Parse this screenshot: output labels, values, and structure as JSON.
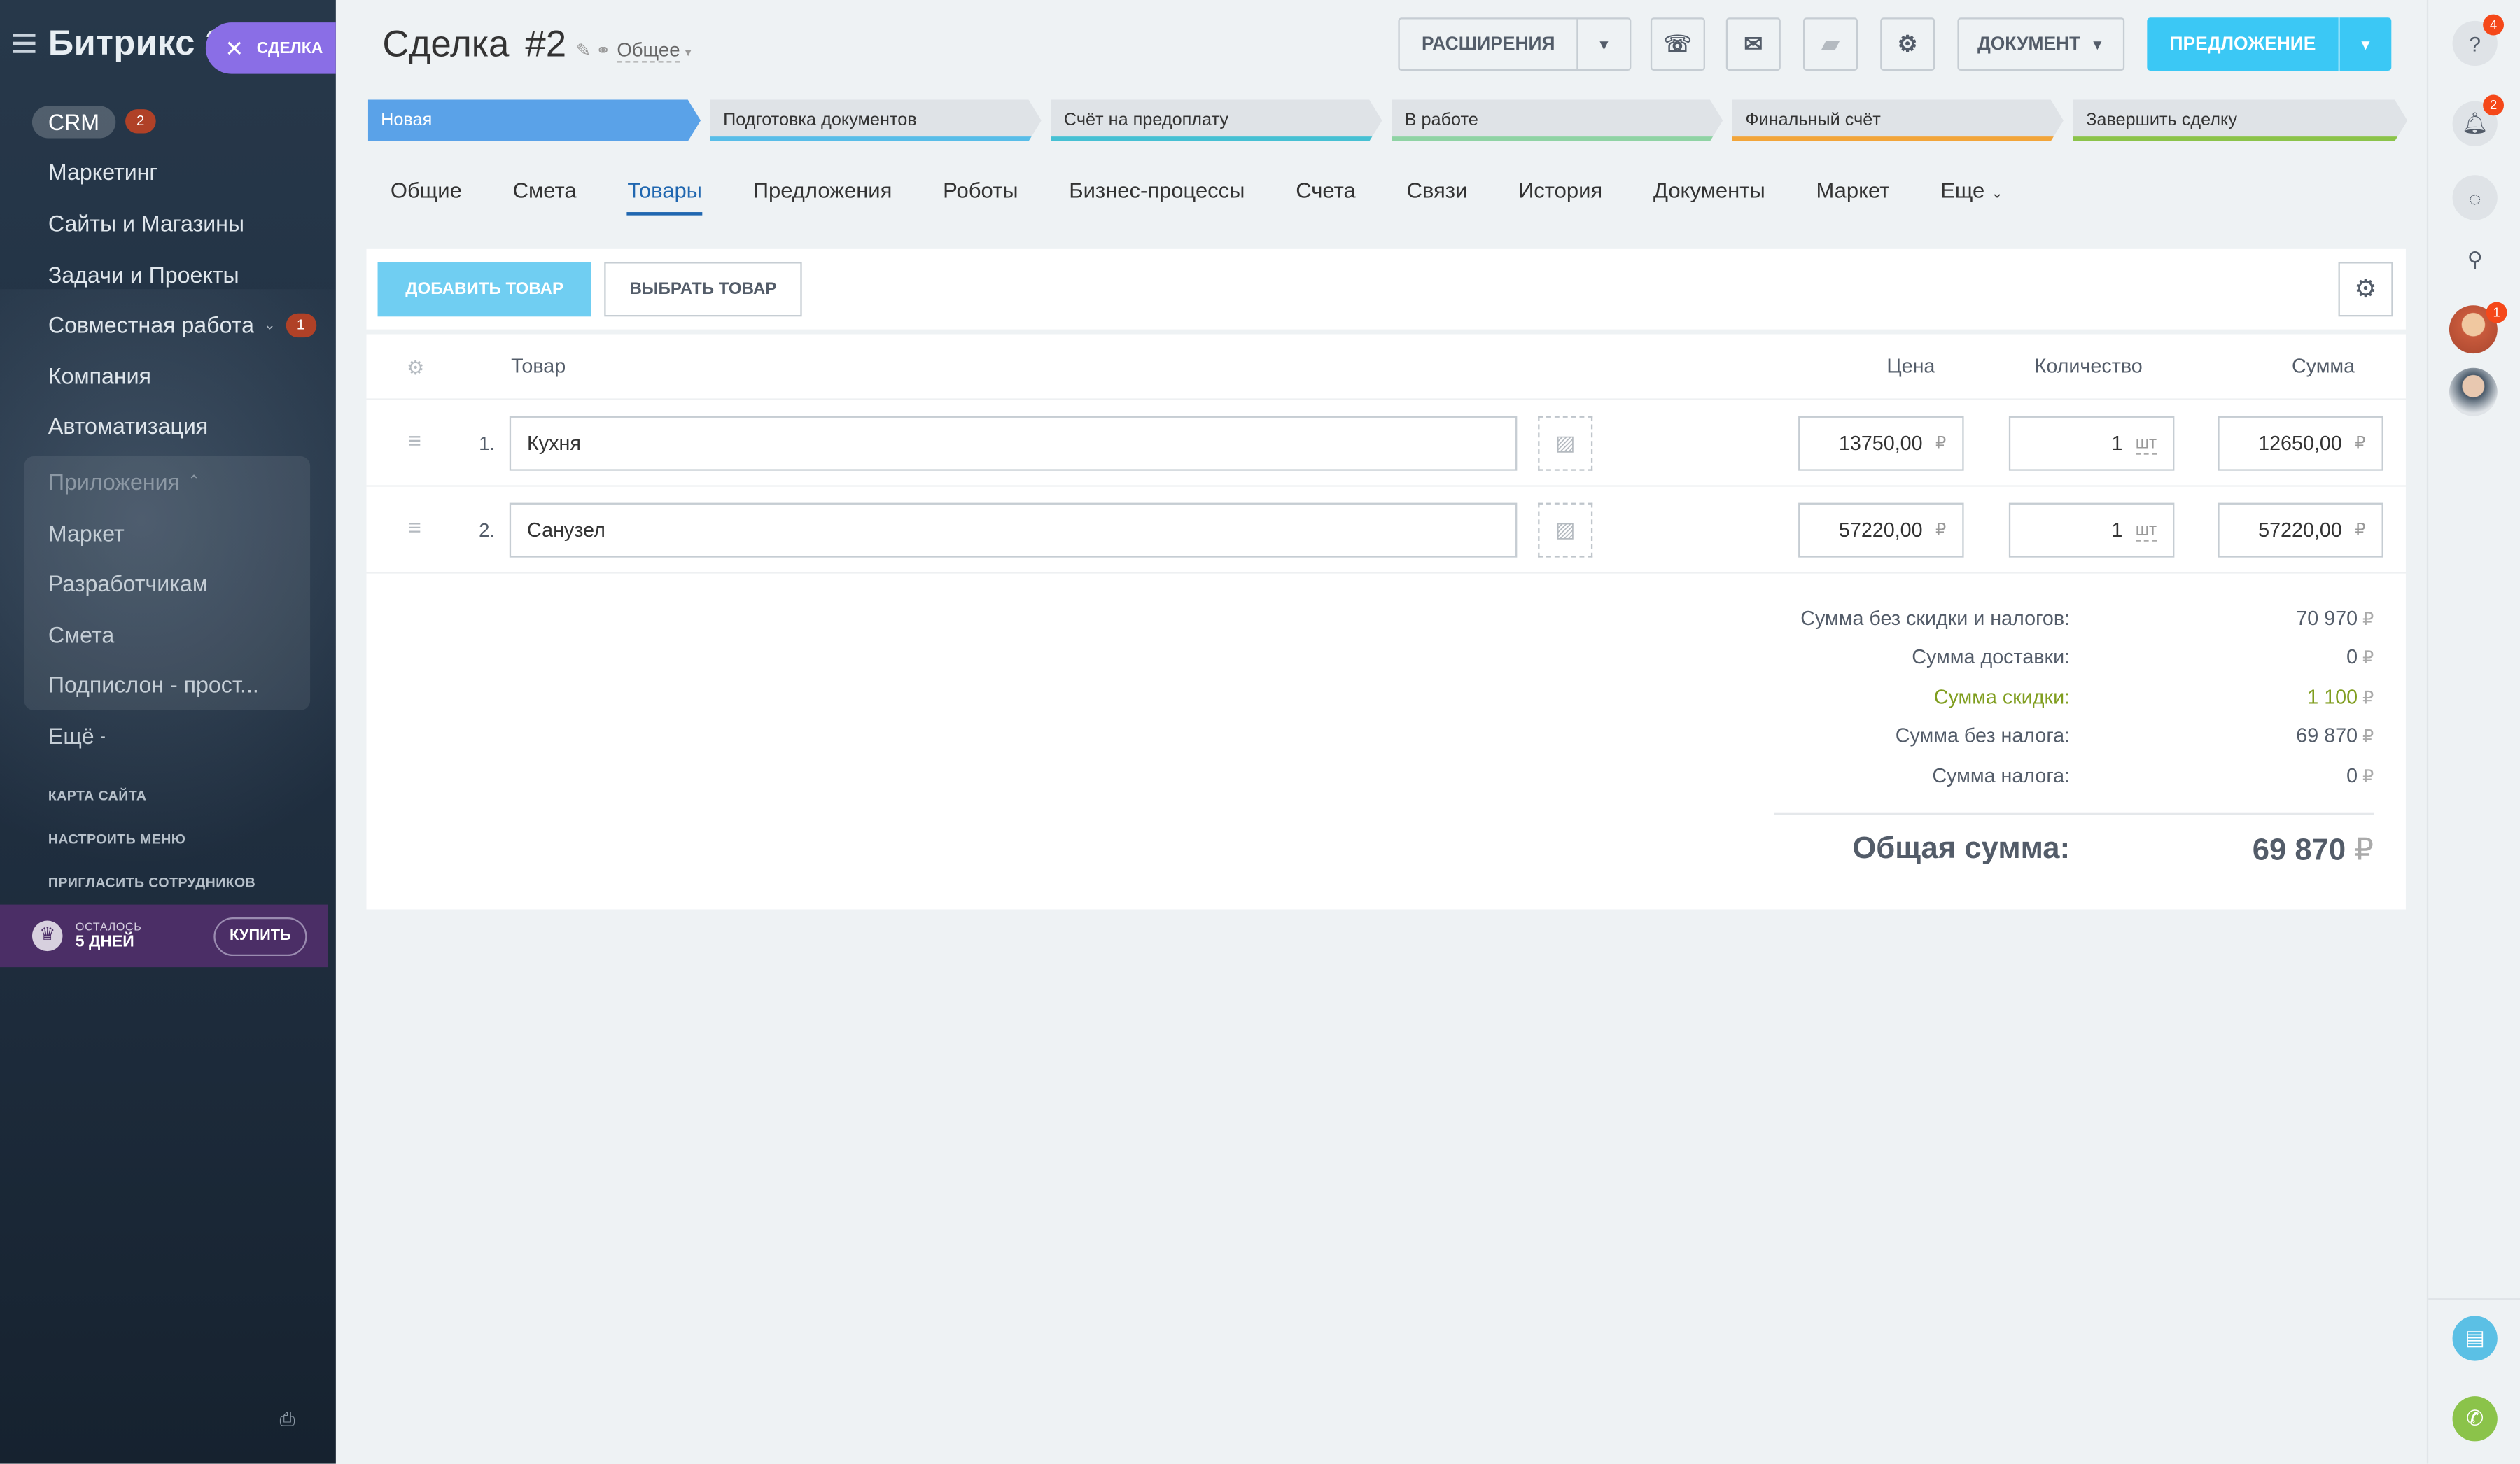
{
  "sidebar": {
    "logo": "Битрикс 24",
    "deal_pill": "СДЕЛКА",
    "crm": {
      "label": "CRM",
      "badge": "2"
    },
    "items": [
      {
        "label": "Маркетинг"
      },
      {
        "label": "Сайты и Магазины"
      },
      {
        "label": "Задачи и Проекты"
      },
      {
        "label": "Совместная работа",
        "badge": "1"
      },
      {
        "label": "Компания"
      },
      {
        "label": "Автоматизация"
      }
    ],
    "apps": {
      "label": "Приложения",
      "items": [
        "Маркет",
        "Разработчикам",
        "Смета",
        "Подпислон - прост..."
      ]
    },
    "more": "Ещё",
    "links": [
      "КАРТА САЙТА",
      "НАСТРОИТЬ МЕНЮ",
      "ПРИГЛАСИТЬ СОТРУДНИКОВ"
    ],
    "trial": {
      "line1": "ОСТАЛОСЬ",
      "line2": "5 ДНЕЙ",
      "buy": "КУПИТЬ"
    }
  },
  "header": {
    "title": "Сделка",
    "number": "#2",
    "category": "Общее",
    "extensions": "РАСШИРЕНИЯ",
    "document": "ДОКУМЕНТ",
    "proposal": "ПРЕДЛОЖЕНИЕ"
  },
  "stages": [
    {
      "label": "Новая",
      "color": "#5aa2e8"
    },
    {
      "label": "Подготовка документов",
      "color": "#58bde8"
    },
    {
      "label": "Счёт на предоплату",
      "color": "#46c0d3"
    },
    {
      "label": "В работе",
      "color": "#8fd3a4"
    },
    {
      "label": "Финальный счёт",
      "color": "#f2a53a"
    },
    {
      "label": "Завершить сделку",
      "color": "#8bc34a"
    }
  ],
  "tabs": [
    "Общие",
    "Смета",
    "Товары",
    "Предложения",
    "Роботы",
    "Бизнес-процессы",
    "Счета",
    "Связи",
    "История",
    "Документы",
    "Маркет",
    "Еще"
  ],
  "active_tab": "Товары",
  "products": {
    "add_button": "ДОБАВИТЬ ТОВАР",
    "select_button": "ВЫБРАТЬ ТОВАР",
    "columns": {
      "product": "Товар",
      "price": "Цена",
      "quantity": "Количество",
      "sum": "Сумма"
    },
    "rows": [
      {
        "num": "1.",
        "name": "Кухня",
        "price": "13750,00",
        "qty": "1",
        "unit": "шт",
        "sum": "12650,00",
        "currency": "₽"
      },
      {
        "num": "2.",
        "name": "Санузел",
        "price": "57220,00",
        "qty": "1",
        "unit": "шт",
        "sum": "57220,00",
        "currency": "₽"
      }
    ]
  },
  "totals": {
    "rows": [
      {
        "label": "Сумма без скидки и налогов:",
        "value": "70 970"
      },
      {
        "label": "Сумма доставки:",
        "value": "0"
      },
      {
        "label": "Сумма скидки:",
        "value": "1 100"
      },
      {
        "label": "Сумма без налога:",
        "value": "69 870"
      },
      {
        "label": "Сумма налога:",
        "value": "0"
      }
    ],
    "grand_label": "Общая сумма:",
    "grand_value": "69 870",
    "currency": "₽"
  },
  "right_panel": {
    "help_badge": "4",
    "notify_badge": "2",
    "avatar_badge": "1"
  }
}
